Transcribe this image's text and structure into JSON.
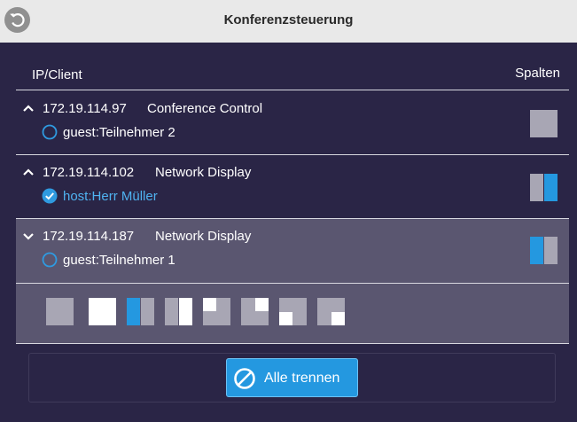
{
  "window": {
    "title": "Konferenzsteuerung"
  },
  "icons": {
    "back": "back-arrow-icon",
    "expanded": "chevron-up-icon",
    "collapsed": "chevron-down-icon",
    "disconnect": "prohibited-icon"
  },
  "colors": {
    "accent": "#2498e0",
    "host_text": "#4fb2f0",
    "background": "#2a2546",
    "titlebar": "#e9e9e9",
    "expanded_row": "#5a5670"
  },
  "table": {
    "col_left": "IP/Client",
    "col_right": "Spalten"
  },
  "clients": [
    {
      "ip": "172.19.114.97",
      "device": "Conference Control",
      "role": "guest:Teilnehmer 2",
      "role_type": "guest",
      "state": "chevron-up",
      "layout": "full-gray"
    },
    {
      "ip": "172.19.114.102",
      "device": "Network Display",
      "role": "host:Herr Müller",
      "role_type": "host",
      "state": "chevron-up",
      "layout": "split-gray-blue"
    },
    {
      "ip": "172.19.114.187",
      "device": "Network Display",
      "role": "guest:Teilnehmer 1",
      "role_type": "guest",
      "state": "chevron-down",
      "layout": "split-blue-gray"
    }
  ],
  "layout_options": [
    "full-gray",
    "full-white",
    "split-blue-gray",
    "split-gray-white",
    "quad-white-topleft",
    "quad-white-topright",
    "quad-white-bottomleft",
    "quad-white-bottomright"
  ],
  "footer": {
    "disconnect_all_label": "Alle trennen"
  }
}
